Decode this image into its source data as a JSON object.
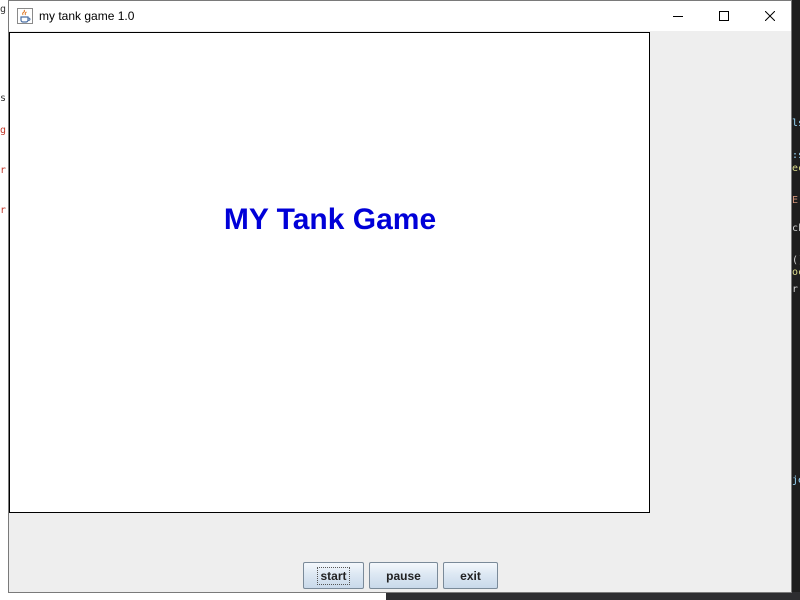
{
  "window": {
    "title": "my tank game 1.0",
    "controls": {
      "minimize": "minimize-icon",
      "maximize": "maximize-icon",
      "close": "close-icon"
    },
    "app_icon": "java-cup-icon"
  },
  "game": {
    "heading": "MY Tank Game",
    "heading_color": "#0000d8",
    "background": "#ffffff"
  },
  "buttons": {
    "start": "start",
    "pause": "pause",
    "exit": "exit",
    "focused": "start"
  },
  "background_glyphs": {
    "left": [
      "g",
      "s:",
      "g",
      "r",
      "r"
    ],
    "right": [
      "ls",
      ":s",
      "ec",
      "E",
      "ck",
      "():",
      "oc",
      "r:",
      "je"
    ]
  }
}
